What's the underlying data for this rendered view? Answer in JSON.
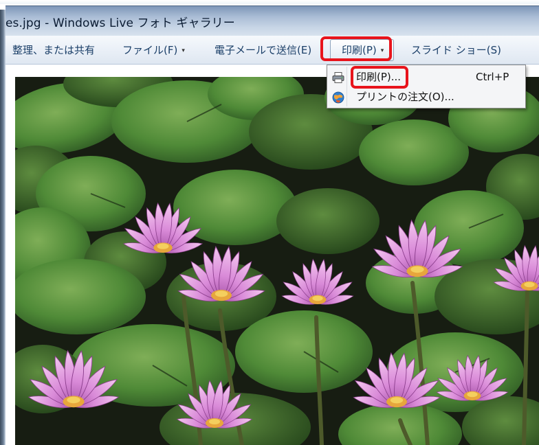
{
  "window": {
    "title": "es.jpg - Windows Live フォト ギャラリー"
  },
  "toolbar": {
    "organize_label": "整理、または共有",
    "file_label": "ファイル(F)",
    "email_label": "電子メールで送信(E)",
    "print_label": "印刷(P)",
    "slideshow_label": "スライド ショー(S)",
    "dropdown_glyph": "▾"
  },
  "print_menu": {
    "items": [
      {
        "label": "印刷(P)...",
        "shortcut": "Ctrl+P",
        "icon": "printer-icon"
      },
      {
        "label": "プリントの注文(O)...",
        "icon": "order-prints-globe-icon"
      }
    ]
  },
  "photo": {
    "subject": "water-lilies-photo"
  },
  "colors": {
    "highlight": "#e8141c",
    "titlebar": "#a9bcd5",
    "command_text": "#1b3f68"
  }
}
